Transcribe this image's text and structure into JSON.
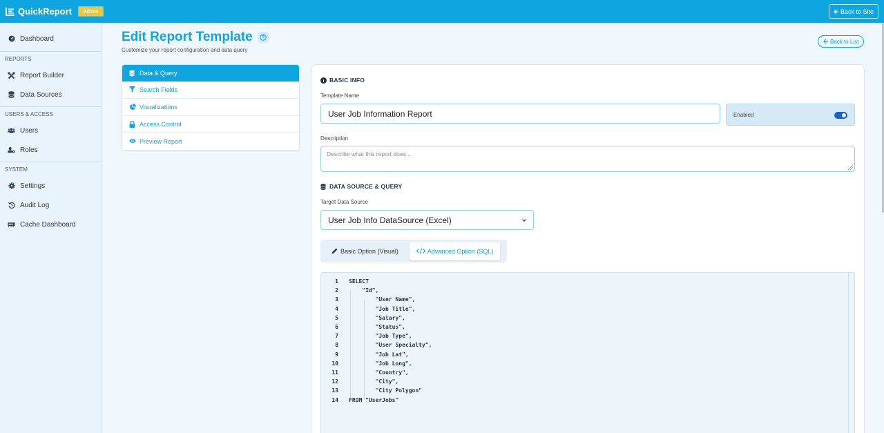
{
  "header": {
    "brand": "QuickReport",
    "badge": "Admin",
    "back_site": "Back to Site"
  },
  "sidebar": {
    "top_item": "Dashboard",
    "sections": [
      {
        "label": "REPORTS",
        "items": [
          "Report Builder",
          "Data Sources"
        ]
      },
      {
        "label": "USERS & ACCESS",
        "items": [
          "Users",
          "Roles"
        ]
      },
      {
        "label": "SYSTEM",
        "items": [
          "Settings",
          "Audit Log",
          "Cache Dashboard"
        ]
      }
    ]
  },
  "page": {
    "title": "Edit Report Template",
    "subtitle": "Customize your report configuration and data query",
    "back_list": "Back to List"
  },
  "menu": {
    "items": [
      "Data & Query",
      "Search Fields",
      "Visualizations",
      "Access Control",
      "Preview Report"
    ],
    "active": "Data & Query"
  },
  "basic_info": {
    "heading": "BASIC INFO",
    "template_name_label": "Template Name",
    "template_name_value": "User Job Information Report",
    "enabled_label": "Enabled",
    "enabled": true,
    "description_label": "Description",
    "description_placeholder": "Describe what this report does..."
  },
  "data_source": {
    "heading": "DATA SOURCE & QUERY",
    "target_label": "Target Data Source",
    "target_value": "User Job Info DataSource (Excel)",
    "tabs": [
      "Basic Option (Visual)",
      "Advanced Option (SQL)"
    ],
    "active_tab": "Advanced Option (SQL)",
    "sql_lines": [
      {
        "n": "1",
        "code": "SELECT"
      },
      {
        "n": "2",
        "code": "    \"Id\","
      },
      {
        "n": "3",
        "code": "        \"User Name\","
      },
      {
        "n": "4",
        "code": "        \"Job Title\","
      },
      {
        "n": "5",
        "code": "        \"Salary\","
      },
      {
        "n": "6",
        "code": "        \"Status\","
      },
      {
        "n": "7",
        "code": "        \"Job Type\","
      },
      {
        "n": "8",
        "code": "        \"User Specialty\","
      },
      {
        "n": "9",
        "code": "        \"Job Lat\","
      },
      {
        "n": "10",
        "code": "        \"Job Long\","
      },
      {
        "n": "11",
        "code": "        \"Country\","
      },
      {
        "n": "12",
        "code": "        \"City\","
      },
      {
        "n": "13",
        "code": "        \"City Polygon\""
      },
      {
        "n": "14",
        "code": "FROM \"UserJobs\""
      }
    ]
  },
  "colors": {
    "primary": "#0ea5e0",
    "badge": "#e3c94a",
    "toggle": "#1a63c7"
  }
}
